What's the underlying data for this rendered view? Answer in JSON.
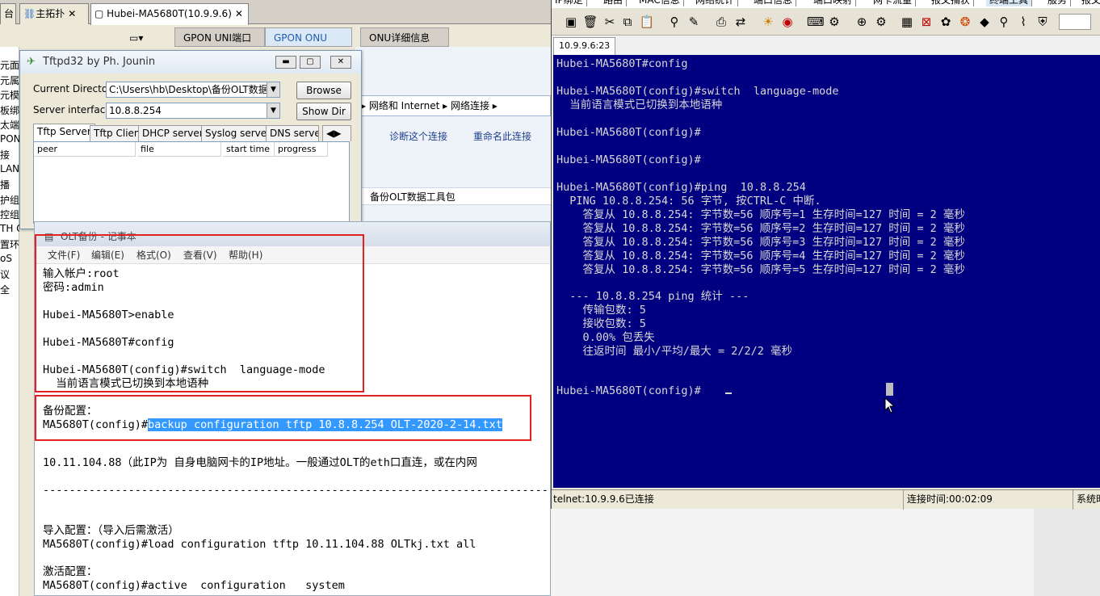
{
  "bg_tabs": [
    {
      "label": "台",
      "close": ""
    },
    {
      "label": "主拓扑",
      "close": "✕"
    },
    {
      "label": "Hubei-MA5680T(10.9.9.6)",
      "close": "✕"
    }
  ],
  "bg_dropdown": "▾",
  "bg_subtabs": [
    "GPON UNI端口",
    "GPON ONU",
    "ONU详细信息"
  ],
  "bg_leftcol": [
    "元面",
    "元属",
    "元模",
    "板绑",
    "太端",
    "PON",
    "接",
    "LAN",
    "播",
    "护组",
    "控组",
    "TH C",
    "置环",
    "oS",
    "议",
    "全"
  ],
  "bg_addr": [
    "网络和 Internet",
    "网络连接"
  ],
  "bg_links": [
    "诊断这个连接",
    "重命名此连接"
  ],
  "bg_backup_item": "备份OLT数据工具包",
  "tftp": {
    "title": "Tftpd32 by Ph. Jounin",
    "current_dir_label": "Current Directory",
    "current_dir": "C:\\Users\\hb\\Desktop\\备份OLT数据]",
    "server_if_label": "Server interface",
    "server_if": "10.8.8.254",
    "browse": "Browse",
    "showdir": "Show Dir",
    "tabs": [
      "Tftp Server",
      "Tftp Client",
      "DHCP server",
      "Syslog server",
      "DNS server"
    ],
    "columns": [
      "peer",
      "file",
      "start time",
      "progress"
    ]
  },
  "notepad": {
    "title": "OLT备份 - 记事本",
    "menu": [
      "文件(F)",
      "编辑(E)",
      "格式(O)",
      "查看(V)",
      "帮助(H)"
    ],
    "lines": [
      "输入帐户:root",
      "密码:admin",
      "",
      "Hubei-MA5680T>enable",
      "",
      "Hubei-MA5680T#config",
      "",
      "Hubei-MA5680T(config)#switch  language-mode",
      "  当前语言模式已切换到本地语种",
      "",
      "备份配置：",
      "",
      "",
      "10.11.104.88（此IP为 自身电脑网卡的IP地址。一般通过OLT的eth口直连，或在内网",
      "",
      "-----------------------------------------------------------------------------------",
      "",
      "",
      "导入配置：（导入后需激活）",
      "MA5680T(config)#load configuration tftp 10.11.104.88 OLTkj.txt all",
      "",
      "激活配置：",
      "MA5680T(config)#active  configuration   system"
    ],
    "backup_prefix": "MA5680T(config)#",
    "backup_selected": "backup configuration tftp 10.8.8.254 OLT-2020-2-14.txt"
  },
  "terminal": {
    "menu": [
      "IP绑定",
      "路由",
      "MAC信息",
      "网络统计",
      "端口信息",
      "端口映射",
      "网卡流量",
      "报文捕获",
      "终端工具",
      "服务",
      "报文"
    ],
    "tab": "10.9.9.6:23",
    "lines": [
      "Hubei-MA5680T#config",
      "",
      "Hubei-MA5680T(config)#switch  language-mode",
      "  当前语言模式已切换到本地语种",
      "",
      "Hubei-MA5680T(config)#",
      "",
      "Hubei-MA5680T(config)#",
      "",
      "Hubei-MA5680T(config)#ping  10.8.8.254",
      "  PING 10.8.8.254: 56 字节, 按CTRL-C 中断.",
      "    答复从 10.8.8.254: 字节数=56 顺序号=1 生存时间=127 时间 = 2 毫秒",
      "    答复从 10.8.8.254: 字节数=56 顺序号=2 生存时间=127 时间 = 2 毫秒",
      "    答复从 10.8.8.254: 字节数=56 顺序号=3 生存时间=127 时间 = 2 毫秒",
      "    答复从 10.8.8.254: 字节数=56 顺序号=4 生存时间=127 时间 = 2 毫秒",
      "    答复从 10.8.8.254: 字节数=56 顺序号=5 生存时间=127 时间 = 2 毫秒",
      "",
      "  --- 10.8.8.254 ping 统计 ---",
      "    传输包数: 5",
      "    接收包数: 5",
      "    0.00% 包丢失",
      "    往返时间 最小/平均/最大 = 2/2/2 毫秒",
      "",
      "",
      "Hubei-MA5680T(config)#"
    ],
    "status": [
      "telnet:10.9.9.6已连接",
      "连接时间:00:02:09",
      "系统时"
    ]
  },
  "colors": {
    "terminal_bg": "#000080",
    "terminal_fg": "#d8d8d8",
    "highlight": "#3399ff",
    "annotation": "#e52020"
  }
}
